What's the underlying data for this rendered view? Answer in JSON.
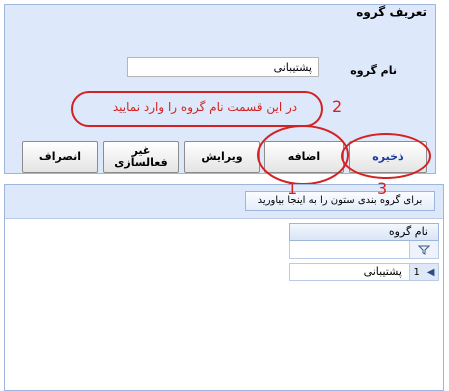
{
  "title": "تعریف گروه",
  "form": {
    "group_name_label": "نام گروه",
    "group_name_value": "پشتیبانی"
  },
  "annotations": {
    "note": "در این قسمت نام گروه را وارد نمایید",
    "note_number": "2",
    "add_number": "1",
    "save_number": "3"
  },
  "buttons": {
    "save": "ذخیره",
    "add": "اضافه",
    "edit": "ویرایش",
    "deactivate_line1": "غیر",
    "deactivate_line2": "فعالسازی",
    "cancel": "انصراف"
  },
  "grid": {
    "group_panel_hint": "برای گروه بندی ستون را به اینجا بیاورید",
    "columns": [
      "نام گروه"
    ],
    "rows": [
      {
        "index": "1",
        "name": "پشتیبانی"
      }
    ]
  },
  "colors": {
    "annotation_red": "#d42222",
    "panel_blue": "#dde8fa"
  }
}
